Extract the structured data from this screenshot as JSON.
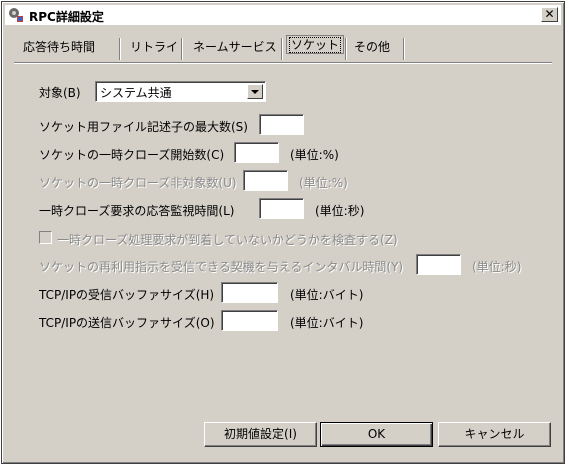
{
  "window": {
    "title": "RPC詳細設定",
    "close_glyph": "✕"
  },
  "tabs": [
    {
      "label": "応答待ち時間"
    },
    {
      "label": "リトライ"
    },
    {
      "label": "ネームサービス"
    },
    {
      "label": "ソケット",
      "active": true
    },
    {
      "label": "その他"
    }
  ],
  "target": {
    "label": "対象(B)",
    "value": "システム共通"
  },
  "fields": {
    "max_fd": {
      "label": "ソケット用ファイル記述子の最大数(S)",
      "value": "",
      "unit": ""
    },
    "close_start": {
      "label": "ソケットの一時クローズ開始数(C)",
      "value": "",
      "unit": "(単位:%)"
    },
    "close_exempt": {
      "label": "ソケットの一時クローズ非対象数(U)",
      "value": "",
      "unit": "(単位:%)"
    },
    "close_timeout": {
      "label": "一時クローズ要求の応答監視時間(L)",
      "value": "",
      "unit": "(単位:秒)"
    },
    "check_arrival": {
      "label": "一時クローズ処理要求が到着していないかどうかを検査する(Z)",
      "checked": false
    },
    "reuse_interval": {
      "label": "ソケットの再利用指示を受信できる契機を与えるインタバル時間(Y)",
      "value": "",
      "unit": "(単位:秒)"
    },
    "recv_buffer": {
      "label": "TCP/IPの受信バッファサイズ(H)",
      "value": "",
      "unit": "(単位:バイト)"
    },
    "send_buffer": {
      "label": "TCP/IPの送信バッファサイズ(O)",
      "value": "",
      "unit": "(単位:バイト)"
    }
  },
  "buttons": {
    "defaults": "初期値設定(I)",
    "ok": "OK",
    "cancel": "キャンセル"
  },
  "colors": {
    "face": "#d4d0c8",
    "disabled_text": "#8a8a8a"
  }
}
